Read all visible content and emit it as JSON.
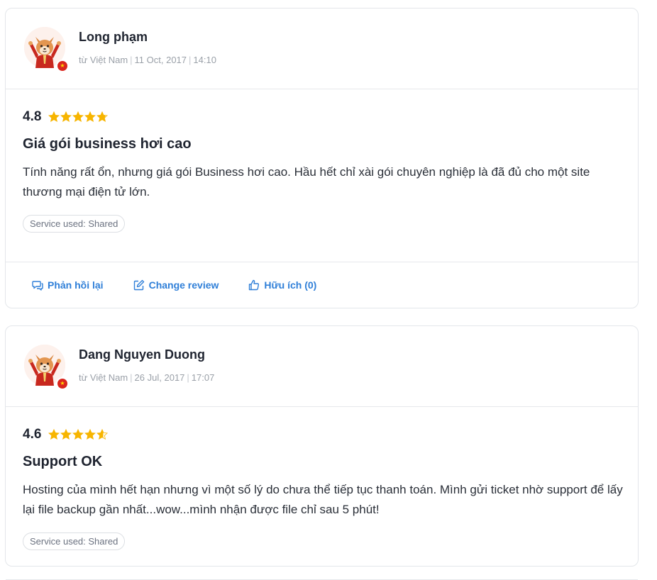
{
  "reviews": [
    {
      "reviewer": "Long phạm",
      "country": "từ Việt Nam",
      "date": "11 Oct, 2017",
      "time": "14:10",
      "rating": "4.8",
      "rating_value": 4.8,
      "title": "Giá gói business hơi cao",
      "text": "Tính năng rất ổn, nhưng giá gói Business hơi cao. Hầu hết chỉ xài gói chuyên nghiệp là đã đủ cho một site thương mại điện tử lớn.",
      "service": "Service used: Shared",
      "actions": {
        "reply": "Phản hồi lại",
        "change": "Change review",
        "helpful": "Hữu ích (0)"
      }
    },
    {
      "reviewer": "Dang Nguyen Duong",
      "country": "từ Việt Nam",
      "date": "26 Jul, 2017",
      "time": "17:07",
      "rating": "4.6",
      "rating_value": 4.6,
      "title": "Support OK",
      "text": "Hosting của mình hết hạn nhưng vì một số lý do chưa thể tiếp tục thanh toán. Mình gửi ticket nhờ support để lấy lại file backup gần nhất...wow...mình nhận được file chỉ sau 5 phút!",
      "service": "Service used: Shared"
    }
  ],
  "colors": {
    "star": "#f7b500",
    "link": "#2f7fd8",
    "flag": "#da251d"
  },
  "icons": [
    "fox-avatar",
    "vietnam-flag-icon",
    "star-icon",
    "reply-icon",
    "edit-icon",
    "thumbs-up-icon"
  ]
}
